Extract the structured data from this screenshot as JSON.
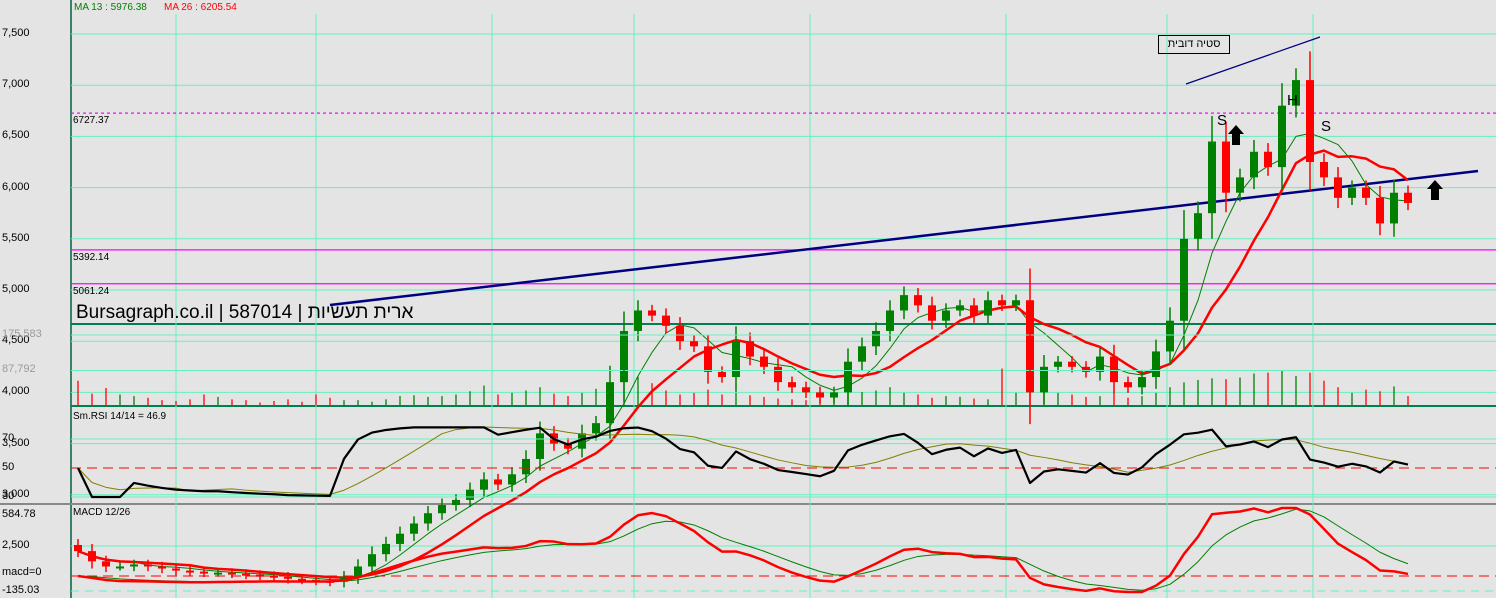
{
  "legend": {
    "ma13": "MA 13 : 5976.38",
    "ma26": "MA 26 : 6205.54"
  },
  "watermark": "Bursagraph.co.il | 587014 | ארית תעשיות",
  "annotation_box": "סטיה דובית",
  "pattern_labels": {
    "s1": "S",
    "h": "H",
    "s2": "S"
  },
  "colors": {
    "up": "#008000",
    "down": "#ff0000",
    "ma13": "#008000",
    "ma26": "#ff0000",
    "grid": "#66f0c0",
    "trend": "#000080",
    "levels": "#ff00ff"
  },
  "chart_data": [
    {
      "type": "candlestick",
      "title": "Price",
      "y_ticks": [
        "7,500",
        "7,000",
        "6,500",
        "6,000",
        "5,500",
        "5,000",
        "4,500",
        "4,000",
        "3,500",
        "3,000",
        "2,500"
      ],
      "y_tick_values": [
        7500,
        7000,
        6500,
        6000,
        5500,
        5000,
        4500,
        4000,
        3500,
        3000,
        2500
      ],
      "levels": [
        {
          "label": "6727.37",
          "value": 6727.37,
          "style": "dashed"
        },
        {
          "label": "5392.14",
          "value": 5392.14,
          "style": "solid"
        },
        {
          "label": "5061.24",
          "value": 5061.24,
          "style": "solid"
        }
      ],
      "closes": [
        2450,
        2350,
        2300,
        2300,
        2320,
        2300,
        2280,
        2260,
        2250,
        2240,
        2240,
        2230,
        2220,
        2210,
        2200,
        2180,
        2170,
        2160,
        2150,
        2200,
        2300,
        2420,
        2520,
        2620,
        2720,
        2820,
        2900,
        2950,
        3050,
        3150,
        3100,
        3200,
        3350,
        3600,
        3500,
        3450,
        3600,
        3700,
        4100,
        4600,
        4800,
        4750,
        4650,
        4500,
        4450,
        4200,
        4150,
        4500,
        4350,
        4250,
        4100,
        4050,
        4000,
        3950,
        4000,
        4300,
        4450,
        4600,
        4800,
        4950,
        4850,
        4700,
        4800,
        4850,
        4750,
        4900,
        4850,
        4900,
        4000,
        4250,
        4300,
        4250,
        4200,
        4350,
        4100,
        4050,
        4150,
        4400,
        4700,
        5500,
        5750,
        6450,
        5950,
        6100,
        6350,
        6200,
        6800,
        7050,
        6250,
        6100,
        5900,
        6000,
        5900,
        5650,
        5950,
        5850
      ]
    },
    {
      "type": "bar",
      "title": "Volume",
      "y_ticks": [
        "175,583",
        "87,792"
      ],
      "y_tick_values": [
        175583,
        87792
      ],
      "values": [
        60000,
        28000,
        42000,
        26000,
        22000,
        18000,
        12000,
        10000,
        14000,
        26000,
        20000,
        14000,
        12000,
        6000,
        10000,
        14000,
        8000,
        26000,
        18000,
        12000,
        12000,
        8000,
        14000,
        22000,
        24000,
        20000,
        22000,
        26000,
        34000,
        48000,
        26000,
        30000,
        36000,
        44000,
        28000,
        22000,
        30000,
        40000,
        52000,
        92000,
        70000,
        54000,
        36000,
        26000,
        30000,
        38000,
        26000,
        30000,
        24000,
        20000,
        16000,
        14000,
        12000,
        16000,
        26000,
        30000,
        32000,
        36000,
        44000,
        30000,
        26000,
        18000,
        22000,
        20000,
        16000,
        14000,
        90000,
        30000,
        196000,
        56000,
        30000,
        26000,
        20000,
        22000,
        28000,
        18000,
        22000,
        30000,
        44000,
        56000,
        62000,
        66000,
        64000,
        68000,
        78000,
        80000,
        84000,
        72000,
        80000,
        60000,
        44000,
        30000,
        38000,
        34000,
        46000,
        22000
      ]
    },
    {
      "type": "line",
      "title": "Sm.RSI 14/14 = 46.9",
      "y_ticks": [
        "70",
        "50",
        "30"
      ],
      "y_tick_values": [
        70,
        50,
        30
      ],
      "reference": 50
    },
    {
      "type": "line",
      "title": "MACD 12/26",
      "y_ticks": [
        "584.78",
        "macd=0",
        "-135.03"
      ],
      "y_tick_values": [
        584.78,
        0,
        -135.03
      ],
      "ylim": [
        -135.03,
        584.78
      ]
    }
  ]
}
